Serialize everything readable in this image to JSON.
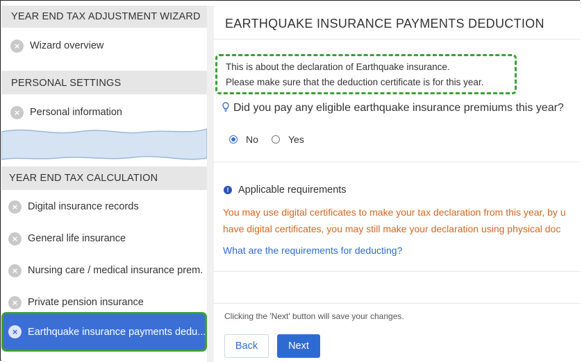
{
  "sidebar": {
    "wizard_heading": "YEAR END TAX ADJUSTMENT WIZARD",
    "wizard_items": [
      {
        "label": "Wizard overview"
      }
    ],
    "personal_heading": "PERSONAL SETTINGS",
    "personal_items": [
      {
        "label": "Personal information"
      }
    ],
    "calc_heading": "YEAR END TAX CALCULATION",
    "calc_items": [
      {
        "label": "Digital insurance records"
      },
      {
        "label": "General life insurance"
      },
      {
        "label": "Nursing care / medical insurance prem."
      },
      {
        "label": "Private pension insurance"
      },
      {
        "label": "Earthquake insurance payments dedu..."
      }
    ],
    "active_item": "Earthquake insurance payments dedu..."
  },
  "main": {
    "title": "EARTHQUAKE INSURANCE PAYMENTS DEDUCTION",
    "note_lines": [
      "This is about the declaration of Earthquake insurance.",
      "Please make sure that the deduction certificate is for this year."
    ],
    "question": "Did you pay any eligible earthquake insurance premiums this year?",
    "options": [
      {
        "label": "No",
        "selected": true
      },
      {
        "label": "Yes",
        "selected": false
      }
    ],
    "requirements_heading": "Applicable requirements",
    "requirements_text": [
      "You may use digital certificates to make your tax declaration from this year, by u",
      "have digital certificates, you may still make your declaration using physical doc"
    ],
    "requirements_link": "What are the requirements for deducting?",
    "footer_note": "Clicking the 'Next' button will save your changes.",
    "back_label": "Back",
    "next_label": "Next"
  },
  "colors": {
    "accent_blue": "#2e6bd1",
    "highlight_green": "#3aa035",
    "warning_orange": "#d4661d",
    "section_gray": "#e6e6e6"
  },
  "icons": {
    "nav_status": "x-circle-icon",
    "question": "lightbulb-icon",
    "requirements": "info-icon"
  }
}
